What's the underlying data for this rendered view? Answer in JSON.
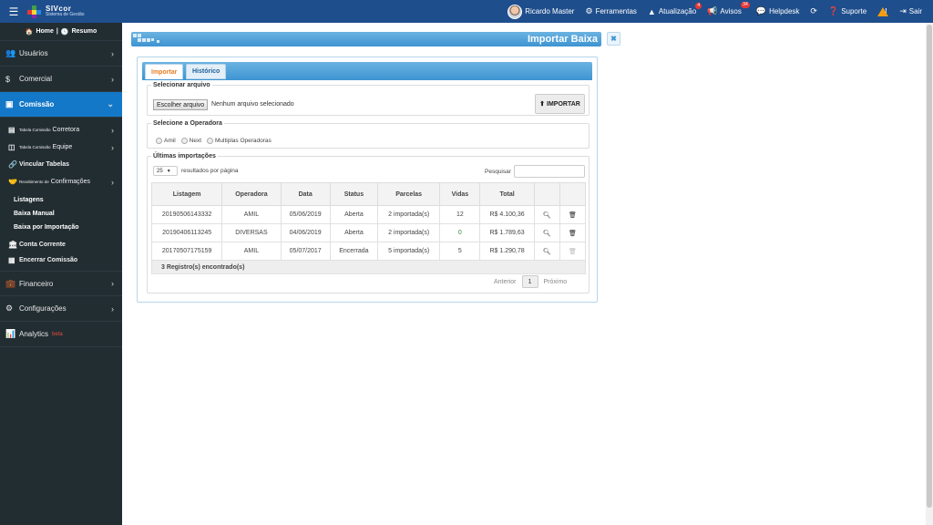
{
  "topbar": {
    "logo_title": "SIVcor",
    "logo_subtitle": "Sistema de Gestão",
    "user_name": "Ricardo Master",
    "ferramentas": "Ferramentas",
    "atualizacao": "Atualização",
    "atualizacao_count": "4",
    "avisos": "Avisos",
    "avisos_count": "34",
    "helpdesk": "Helpdesk",
    "suporte": "Suporte",
    "sair": "Sair"
  },
  "sidebar": {
    "home": "Home",
    "resumo": "Resumo",
    "usuarios": "Usuários",
    "comercial": "Comercial",
    "comissao": "Comissão",
    "tabela_corretora_small": "Tabela Comissão",
    "tabela_corretora_big": "Corretora",
    "tabela_equipe_small": "Tabela Comissão",
    "tabela_equipe_big": "Equipe",
    "vincular_tabelas": "Vincular Tabelas",
    "receb_small": "Recebimento de",
    "receb_big": "Confirmações",
    "listagens": "Listagens",
    "baixa_manual": "Baixa Manual",
    "baixa_importacao": "Baixa por Importação",
    "conta_corrente": "Conta Corrente",
    "encerrar_comissao": "Encerrar Comissão",
    "financeiro": "Financeiro",
    "configuracoes": "Configurações",
    "analytics": "Analytics",
    "beta": "beta"
  },
  "page": {
    "title": "Importar Baixa",
    "tab_importar": "Importar",
    "tab_historico": "Histórico"
  },
  "file_section": {
    "legend": "Selecionar arquivo",
    "choose_button": "Escolher arquivo",
    "status": "Nenhum arquivo selecionado",
    "import_button": "IMPORTAR"
  },
  "operadora_section": {
    "legend": "Selecione a Operadora",
    "options": [
      "Amil",
      "Next",
      "Multiplas Operadoras"
    ]
  },
  "imports_section": {
    "legend": "Últimas importações",
    "page_length": "25",
    "page_length_label": "resultados por página",
    "search_label": "Pesquisar",
    "columns": [
      "Listagem",
      "Operadora",
      "Data",
      "Status",
      "Parcelas",
      "Vidas",
      "Total"
    ],
    "rows": [
      {
        "listagem": "20190506143332",
        "operadora": "AMIL",
        "data": "05/06/2019",
        "status": "Aberta",
        "parcelas": "2 importada(s)",
        "vidas": "12",
        "total": "R$ 4.100,36"
      },
      {
        "listagem": "20190406113245",
        "operadora": "DIVERSAS",
        "data": "04/06/2019",
        "status": "Aberta",
        "parcelas": "2 importada(s)",
        "vidas": "0",
        "total": "R$ 1.789,63"
      },
      {
        "listagem": "20170507175159",
        "operadora": "AMIL",
        "data": "05/07/2017",
        "status": "Encerrada",
        "parcelas": "5 importada(s)",
        "vidas": "5",
        "total": "R$ 1.290,78"
      }
    ],
    "footer": "3 Registro(s) encontrado(s)",
    "pager_prev": "Anterior",
    "pager_current": "1",
    "pager_next": "Próximo"
  },
  "colors": {
    "topbar": "#1f4e8c",
    "sidebar": "#222d32",
    "sidebar_active": "#1478c8",
    "header_blue": "#3e94d1",
    "tab_active_text": "#e67e22"
  },
  "icons": {
    "menu": "hamburger-icon",
    "home": "home-icon",
    "clock": "clock-icon",
    "users": "users-icon",
    "dollar": "dollar-icon",
    "comissao": "money-icon",
    "table": "table-icon",
    "link": "link-icon",
    "handshake": "handshake-icon",
    "bank": "bank-icon",
    "close_account": "close-account-icon",
    "financeiro": "briefcase-icon",
    "config": "gears-icon",
    "analytics": "chart-icon",
    "upload": "upload-icon",
    "search": "search-icon",
    "trash": "trash-icon"
  }
}
